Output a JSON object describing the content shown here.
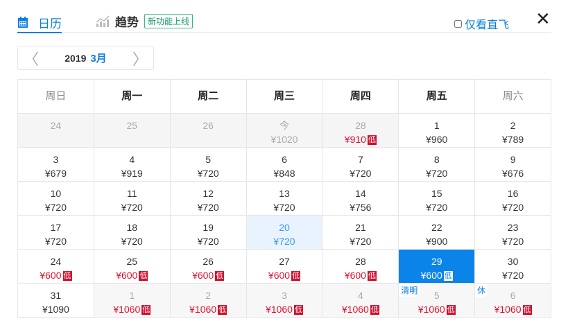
{
  "tabs": {
    "calendar": "日历",
    "trend": "趋势",
    "new_badge": "新功能上线"
  },
  "direct_only": "仅看直飞",
  "close": "✕",
  "nav": {
    "year": "2019",
    "month": "3月",
    "prev": "〈",
    "next": "〉"
  },
  "weekdays": [
    "周日",
    "周一",
    "周二",
    "周三",
    "周四",
    "周五",
    "周六"
  ],
  "low_label": "低",
  "colors": {
    "accent": "#0b84ea",
    "low": "#d0102e"
  },
  "weeks": [
    [
      {
        "d": "24",
        "s": "past"
      },
      {
        "d": "25",
        "s": "past"
      },
      {
        "d": "26",
        "s": "past"
      },
      {
        "d": "今",
        "p": "¥1020",
        "s": "past"
      },
      {
        "d": "28",
        "p": "¥910",
        "low": true,
        "s": "past"
      },
      {
        "d": "1",
        "p": "¥960"
      },
      {
        "d": "2",
        "p": "¥789"
      }
    ],
    [
      {
        "d": "3",
        "p": "¥679"
      },
      {
        "d": "4",
        "p": "¥919"
      },
      {
        "d": "5",
        "p": "¥720"
      },
      {
        "d": "6",
        "p": "¥848"
      },
      {
        "d": "7",
        "p": "¥720"
      },
      {
        "d": "8",
        "p": "¥720"
      },
      {
        "d": "9",
        "p": "¥676"
      }
    ],
    [
      {
        "d": "10",
        "p": "¥720"
      },
      {
        "d": "11",
        "p": "¥720"
      },
      {
        "d": "12",
        "p": "¥720"
      },
      {
        "d": "13",
        "p": "¥720"
      },
      {
        "d": "14",
        "p": "¥756"
      },
      {
        "d": "15",
        "p": "¥720"
      },
      {
        "d": "16",
        "p": "¥720"
      }
    ],
    [
      {
        "d": "17",
        "p": "¥720"
      },
      {
        "d": "18",
        "p": "¥720"
      },
      {
        "d": "19",
        "p": "¥720"
      },
      {
        "d": "20",
        "p": "¥720",
        "s": "hover"
      },
      {
        "d": "21",
        "p": "¥720"
      },
      {
        "d": "22",
        "p": "¥900"
      },
      {
        "d": "23",
        "p": "¥720"
      }
    ],
    [
      {
        "d": "24",
        "p": "¥600",
        "low": true
      },
      {
        "d": "25",
        "p": "¥600",
        "low": true
      },
      {
        "d": "26",
        "p": "¥600",
        "low": true
      },
      {
        "d": "27",
        "p": "¥600",
        "low": true
      },
      {
        "d": "28",
        "p": "¥600",
        "low": true
      },
      {
        "d": "29",
        "p": "¥600",
        "low": true,
        "s": "sel"
      },
      {
        "d": "30",
        "p": "¥720"
      }
    ],
    [
      {
        "d": "31",
        "p": "¥1090"
      },
      {
        "d": "1",
        "p": "¥1060",
        "low": true,
        "s": "other"
      },
      {
        "d": "2",
        "p": "¥1060",
        "low": true,
        "s": "other"
      },
      {
        "d": "3",
        "p": "¥1060",
        "low": true,
        "s": "other"
      },
      {
        "d": "4",
        "p": "¥1060",
        "low": true,
        "s": "other"
      },
      {
        "d": "5",
        "p": "¥1060",
        "low": true,
        "s": "other",
        "tag": "清明"
      },
      {
        "d": "6",
        "p": "¥1060",
        "low": true,
        "s": "other",
        "tag": "休"
      }
    ]
  ]
}
